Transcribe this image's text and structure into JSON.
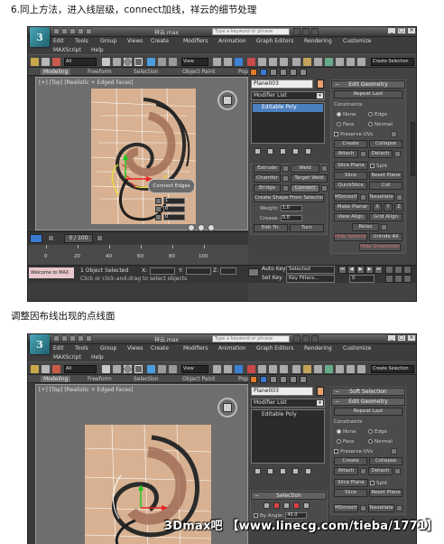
{
  "captions": {
    "step": "6.同上方法，进入线层级，connect加线，祥云的细节处理",
    "adjust": "调整因布线出现的点线面"
  },
  "app": {
    "logo_text": "3",
    "file_title": "祥云.max",
    "search_placeholder": "Type a keyword or phrase",
    "window_controls": [
      "_",
      "□",
      "×"
    ]
  },
  "menus": [
    "Edit",
    "Tools",
    "Group",
    "Views",
    "Create",
    "Modifiers",
    "Animation",
    "Graph Editors",
    "Rendering",
    "Customize"
  ],
  "menus_row2": [
    "MAXScript",
    "Help"
  ],
  "toolbar": {
    "filter": "All",
    "coord": "View",
    "selection_set": "Create Selection"
  },
  "ribbon_tabs": [
    "Modeling",
    "Freeform",
    "Selection",
    "Object Paint",
    "Populate"
  ],
  "viewport": {
    "label": "[+] [Top] [Realistic + Edged Faces]",
    "caddy": "Connect Edges",
    "caddy_values": [
      "1",
      "0",
      "0"
    ]
  },
  "command_panel": {
    "object_name": "Plane003",
    "modifier_list": "Modifier List",
    "stack_item": "Editable Poly",
    "swatch_color": "#e8a06e"
  },
  "edit_edges": {
    "rows": [
      [
        "Extrude",
        "Weld"
      ],
      [
        "Chamfer",
        "Target Weld"
      ],
      [
        "Bridge",
        "Connect"
      ]
    ],
    "create_shape": "Create Shape From Selection",
    "weight_label": "Weight:",
    "weight_value": "1.0",
    "crease_label": "Crease:",
    "crease_value": "0.0",
    "tri_buttons": [
      "Edit Tri.",
      "Turn"
    ]
  },
  "edit_geometry": {
    "title": "Edit Geometry",
    "repeat_last": "Repeat Last",
    "constraints": "Constraints",
    "options": [
      "None",
      "Edge",
      "Face",
      "Normal"
    ],
    "preserve_uvs": "Preserve UVs",
    "create": "Create",
    "collapse": "Collapse",
    "attach": "Attach",
    "detach": "Detach",
    "slice_plane": "Slice Plane",
    "split": "Split",
    "slice": "Slice",
    "reset_plane": "Reset Plane",
    "quickslice": "QuickSlice",
    "cut": "Cut",
    "msmooth": "MSmooth",
    "tessellate": "Tessellate",
    "make_planar": "Make Planar",
    "xyz": [
      "X",
      "Y",
      "Z"
    ],
    "view_align": "View Align",
    "grid_align": "Grid Align",
    "relax": "Relax",
    "hide_selected": "Hide Selected",
    "unhide_all": "Unhide All",
    "hide_unselected": "Hide Unselected"
  },
  "timeline": {
    "frame": "0 / 100",
    "ticks": [
      "0",
      "20",
      "40",
      "60",
      "80",
      "100"
    ]
  },
  "status": {
    "maxscript": "Welcome to MAX",
    "selected": "1 Object Selected",
    "prompt": "Click or click-and-drag to select objects",
    "x_label": "X:",
    "y_label": "Y:",
    "z_label": "Z:",
    "auto_key": "Auto Key",
    "selected_dd": "Selected",
    "set_key": "Set Key",
    "key_filters": "Key Filters...",
    "frame_value": "0"
  },
  "command_panel_2": {
    "soft_selection": "Soft Selection",
    "edit_geometry": "Edit Geometry",
    "repeat_last": "Repeat Last",
    "constraints": "Constraints",
    "options": [
      "None",
      "Edge",
      "Face",
      "Normal"
    ],
    "preserve_uvs": "Preserve UVs",
    "create": "Create",
    "collapse": "Collapse",
    "attach": "Attach",
    "detach": "Detach",
    "slice_plane": "Slice Plane",
    "split": "Split",
    "slice": "Slice",
    "reset_plane": "Reset Plane",
    "msmooth": "MSmooth",
    "tessellate": "Tessellate",
    "selection": "Selection",
    "by_angle": "By Angle:",
    "by_angle_value": "45.0"
  },
  "watermark": "3Dmax吧 【www.linecg.com/tieba/1771】"
}
